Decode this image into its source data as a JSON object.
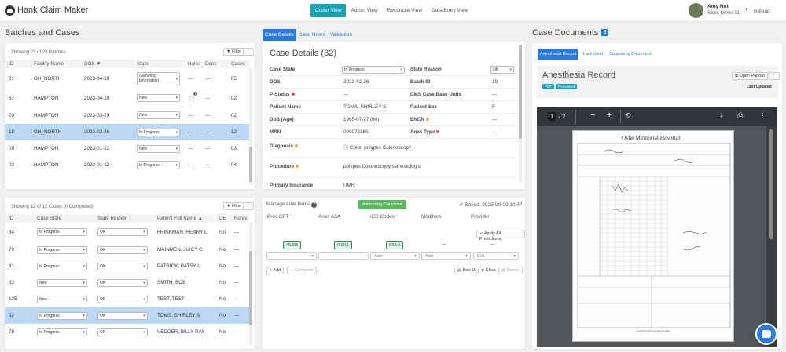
{
  "app": {
    "title": "Hank Claim Maker"
  },
  "nav": {
    "tabs": [
      "Coder View",
      "Admin View",
      "Reconcile View",
      "Data Entry View"
    ],
    "active": "Coder View"
  },
  "user": {
    "name": "Amy Noll",
    "role": "Sales Demo 01",
    "reload": "Reload"
  },
  "batches": {
    "section_title": "Batches and Cases",
    "showing": "Showing 23 of 23 Batches",
    "filter": "Filter",
    "more": "⋮",
    "columns": [
      "ID",
      "Facility Name",
      "DOS",
      "State",
      "Notes",
      "Docs",
      "Cases"
    ],
    "sort_indicator": "▼",
    "rows": [
      {
        "id": "21",
        "facility": "GH_NORTH",
        "dos": "2023-04-19",
        "state": "Gathering Information",
        "notes": "---",
        "docs": "---",
        "cases": "05"
      },
      {
        "id": "67",
        "facility": "HAMPTON",
        "dos": "2023-04-19",
        "state": "New",
        "notes": "1",
        "docs": "---",
        "cases": "02"
      },
      {
        "id": "20",
        "facility": "HAMPTON",
        "dos": "2023-03-29",
        "state": "New",
        "notes": "---",
        "docs": "---",
        "cases": "02"
      },
      {
        "id": "19",
        "facility": "GH_NORTH",
        "dos": "2023-02-26",
        "state": "In Progress",
        "notes": "---",
        "docs": "---",
        "cases": "12"
      },
      {
        "id": "09",
        "facility": "HAMPTON",
        "dos": "2023-01-22",
        "state": "New",
        "notes": "---",
        "docs": "---",
        "cases": "03"
      },
      {
        "id": "03",
        "facility": "HAMPTON",
        "dos": "2023-01-12",
        "state": "In Progress",
        "notes": "---",
        "docs": "---",
        "cases": "04"
      }
    ]
  },
  "cases": {
    "showing": "Showing 12 of 12 Cases (0 Completed)",
    "filter": "Filter",
    "more": "⋮",
    "columns": [
      "ID",
      "Case State",
      "State Reason",
      "Patient Full Name",
      "DE",
      "Notes"
    ],
    "sort_indicator": "▲",
    "rows": [
      {
        "id": "84",
        "state": "In Progress",
        "reason": "OK",
        "name": "FRINKMAN, HENRY L",
        "de": "No",
        "notes": "---"
      },
      {
        "id": "79",
        "state": "In Progress",
        "reason": "OK",
        "name": "MAINMEN, JUICY C",
        "de": "No",
        "notes": "---"
      },
      {
        "id": "81",
        "state": "In Progress",
        "reason": "OK",
        "name": "PATRICK, PATSY L",
        "de": "No",
        "notes": "---"
      },
      {
        "id": "83",
        "state": "New",
        "reason": "OK",
        "name": "SMITH, BOB",
        "de": "No",
        "notes": "---"
      },
      {
        "id": "135",
        "state": "New",
        "reason": "OK",
        "name": "TEST, TEST",
        "de": "No",
        "notes": "---"
      },
      {
        "id": "82",
        "state": "In Progress",
        "reason": "OK",
        "name": "TOMS, SHIRLEY S",
        "de": "No",
        "notes": "---"
      },
      {
        "id": "78",
        "state": "In Progress",
        "reason": "OK",
        "name": "VEDDER, BILLY RAY",
        "de": "No",
        "notes": "---"
      }
    ]
  },
  "case_details": {
    "tabs": [
      "Case Details",
      "Case Notes",
      "Validation"
    ],
    "title": "Case Details (82)",
    "case_state_label": "Case State",
    "case_state": "In Progress",
    "state_reason_label": "State Reason",
    "state_reason": "OK",
    "dos_label": "DOS",
    "dos": "2023-02-26",
    "batch_id_label": "Batch ID",
    "batch_id": "19",
    "pstatus_label": "P-Status",
    "pstatus": "---",
    "cms_label": "CMS Case Base Units",
    "cms": "---",
    "patient_name_label": "Patient Name",
    "patient_name": "TOMS, SHIRLEY S",
    "patient_sex_label": "Patient Sex",
    "patient_sex": "F",
    "dob_label": "DoB (Age)",
    "dob": "1965-07-27 (60)",
    "encn_label": "ENCN",
    "encn": "---",
    "mrn_label": "MRN",
    "mrn": "000072165",
    "anes_type_label": "Anes Type",
    "anes_type": "---",
    "diagnosis_label": "Diagnosis",
    "diagnosis": "Colon polypes Colonoscopy",
    "procedure_label": "Procedure",
    "procedure": "polypes Colonoscopy sstheslologist",
    "insurance_label": "Primary Insurance",
    "insurance": "UMR"
  },
  "line_items": {
    "title": "Manage Line Items",
    "status_badge": "Autocoding Completed",
    "saved": "Saved: 2025-09-09 10:47",
    "columns": [
      "Proc CPT",
      "Anes ASA",
      "ICD Codes",
      "Modifiers",
      "Provider"
    ],
    "apply": "Apply All Predictions",
    "predicted": {
      "cpt": "45385",
      "asa": "00811",
      "icd": "K63.5",
      "modifiers": "---",
      "provider": "---"
    },
    "inputs": {
      "cpt": "---",
      "asa": "---",
      "icd": "Add",
      "modifiers": "Add",
      "provider": "Edit"
    },
    "buttons": {
      "add": "Add",
      "complete": "Complete",
      "box": "Box 19",
      "clear": "Clear",
      "delete": "Delete"
    }
  },
  "documents": {
    "section_title": "Case Documents",
    "count": "3",
    "tabs": [
      "Anesthesia Record",
      "Facesheet",
      "Supporting Document"
    ],
    "doc_title": "Anesthesia Record",
    "badges": [
      "PDF",
      "Processed"
    ],
    "open_popout": "Open Popout",
    "last_updated": "Last Updated",
    "pdf": {
      "page": "1",
      "total": "/ 2"
    },
    "paper_header": "Oshe Memorial Hospital",
    "paper_footer": "ANESTHESIA RECORD"
  },
  "colors": {
    "accent": "#17a2b8",
    "primary": "#2a7ae2",
    "selected_row": "#bcd9f3",
    "success": "#5cb85c"
  }
}
